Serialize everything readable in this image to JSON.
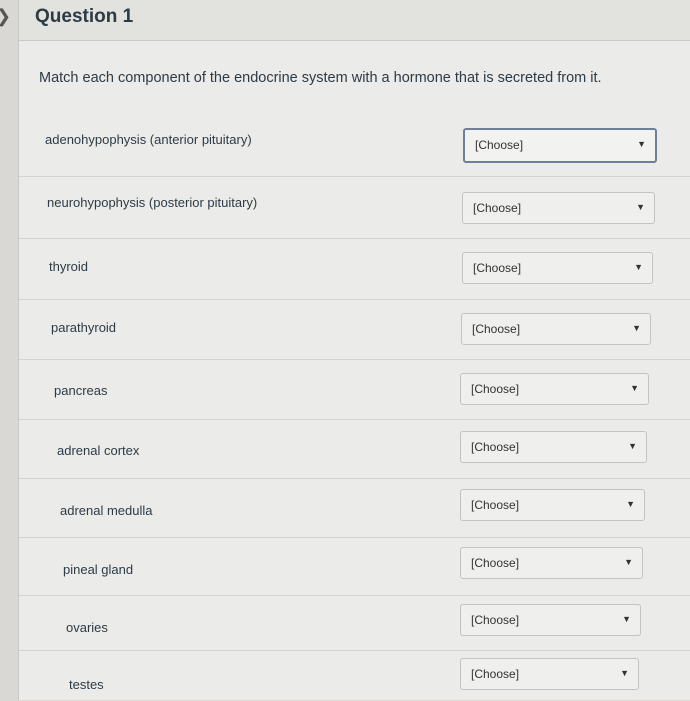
{
  "question": {
    "title": "Question 1",
    "prompt": "Match each component of the endocrine system with a hormone that is secreted from it."
  },
  "items": [
    {
      "label": "adenohypophysis (anterior pituitary)",
      "selected": "[Choose]"
    },
    {
      "label": "neurohypophysis (posterior pituitary)",
      "selected": "[Choose]"
    },
    {
      "label": "thyroid",
      "selected": "[Choose]"
    },
    {
      "label": "parathyroid",
      "selected": "[Choose]"
    },
    {
      "label": "pancreas",
      "selected": "[Choose]"
    },
    {
      "label": "adrenal cortex",
      "selected": "[Choose]"
    },
    {
      "label": "adrenal medulla",
      "selected": "[Choose]"
    },
    {
      "label": "pineal gland",
      "selected": "[Choose]"
    },
    {
      "label": "ovaries",
      "selected": "[Choose]"
    },
    {
      "label": "testes",
      "selected": "[Choose]"
    }
  ],
  "icons": {
    "nav": "chevron-left-icon",
    "dropdown": "caret-down-icon"
  },
  "colors": {
    "text": "#2d3b45",
    "focus_border": "#6f7f95"
  }
}
